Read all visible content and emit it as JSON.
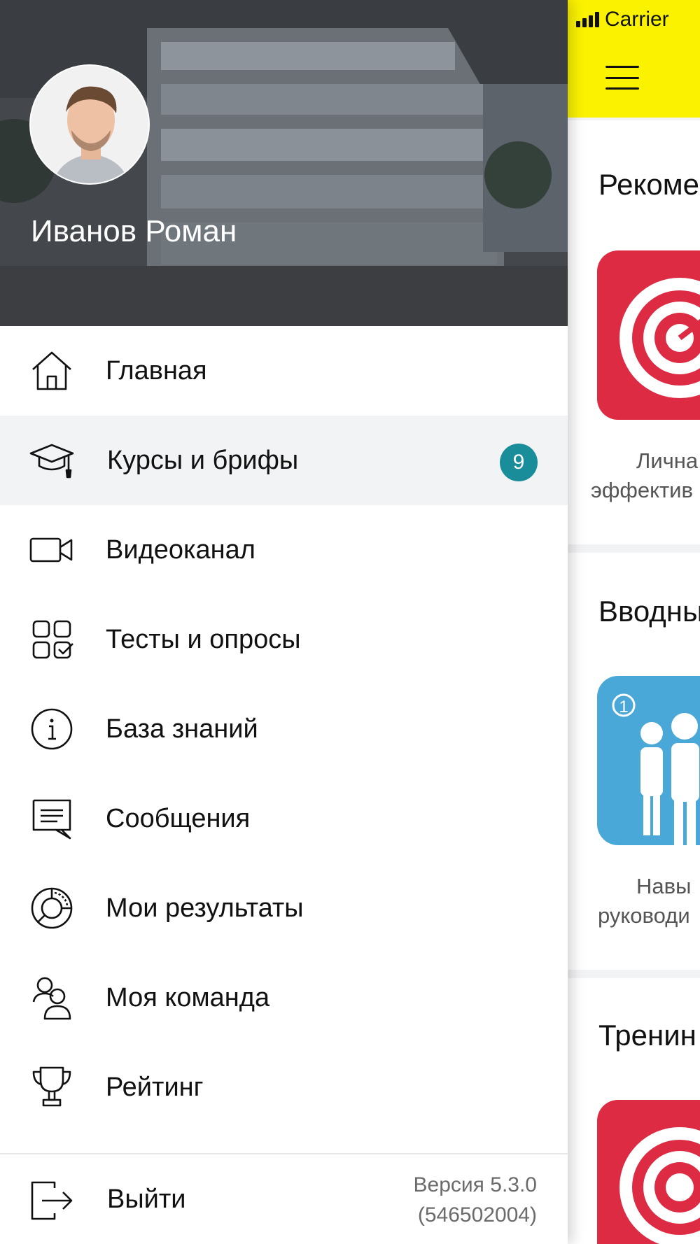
{
  "status_bar": {
    "carrier": "Carrier"
  },
  "main": {
    "sections": [
      {
        "title": "Рекоме",
        "caption": [
          "Лична",
          "эффектив"
        ]
      },
      {
        "title": "Вводны",
        "caption": [
          "Навы",
          "руководи"
        ]
      },
      {
        "title": "Тренин"
      }
    ],
    "tile_badge": "1"
  },
  "drawer": {
    "user_name": "Иванов Роман",
    "menu": [
      {
        "label": "Главная",
        "icon": "home-icon"
      },
      {
        "label": "Курсы и брифы",
        "icon": "graduation-cap-icon",
        "badge": "9",
        "active": true
      },
      {
        "label": "Видеоканал",
        "icon": "video-camera-icon"
      },
      {
        "label": "Тесты и опросы",
        "icon": "tests-grid-icon"
      },
      {
        "label": "База знаний",
        "icon": "info-icon"
      },
      {
        "label": "Сообщения",
        "icon": "message-icon"
      },
      {
        "label": "Мои результаты",
        "icon": "results-chart-icon"
      },
      {
        "label": "Моя команда",
        "icon": "team-icon"
      },
      {
        "label": "Рейтинг",
        "icon": "trophy-icon"
      }
    ],
    "logout_label": "Выйти",
    "version_line1": "Версия 5.3.0",
    "version_line2": "(546502004)"
  },
  "colors": {
    "topbar": "#fbf200",
    "badge": "#1a8d9a",
    "active_row": "#f2f3f5",
    "tile_red": "#de2b44",
    "tile_blue": "#4aa8d8"
  }
}
